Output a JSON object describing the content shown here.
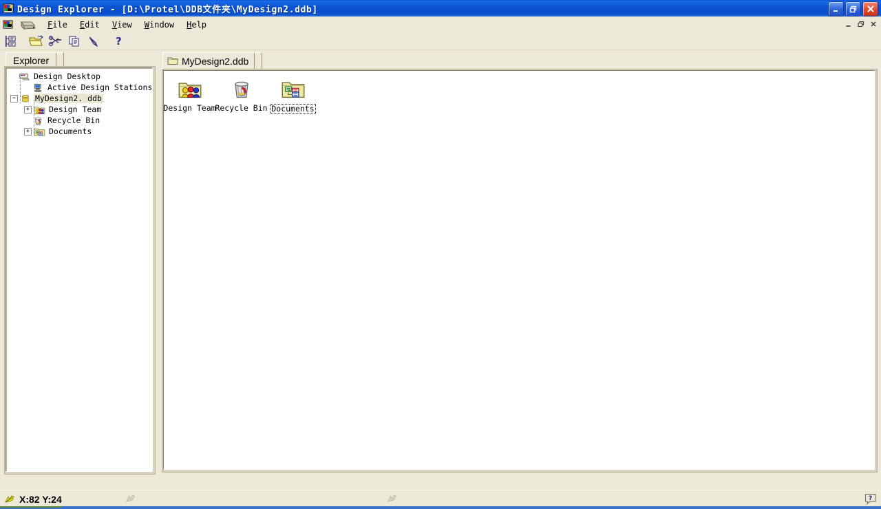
{
  "window": {
    "title": "Design Explorer - [D:\\Protel\\DDB文件夹\\MyDesign2.ddb]",
    "app_icon": "design-explorer-icon",
    "controls": {
      "minimize": "Minimize",
      "maximize": "Restore",
      "close": "Close"
    },
    "mdi_controls": {
      "minimize": "Minimize Document",
      "restore": "Restore Document",
      "close": "Close Document"
    }
  },
  "menubar": {
    "items": [
      {
        "label": "File",
        "accel": "F"
      },
      {
        "label": "Edit",
        "accel": "E"
      },
      {
        "label": "View",
        "accel": "V"
      },
      {
        "label": "Window",
        "accel": "W"
      },
      {
        "label": "Help",
        "accel": "H"
      }
    ]
  },
  "toolbar": {
    "buttons": [
      {
        "name": "design-manager-icon",
        "tooltip": "Toggle Design Manager"
      },
      {
        "name": "open-folder-icon",
        "tooltip": "Open"
      },
      {
        "name": "cut-scissors-icon",
        "tooltip": "Cut"
      },
      {
        "name": "copy-icon",
        "tooltip": "Copy"
      },
      {
        "name": "paste-icon",
        "tooltip": "Paste"
      },
      {
        "name": "help-question-icon",
        "tooltip": "Help"
      }
    ]
  },
  "explorer": {
    "tab_label": "Explorer",
    "tree": [
      {
        "label": "Design Desktop",
        "indent": 0,
        "expander": "none",
        "icon": "design-desktop-icon",
        "selected": false
      },
      {
        "label": "Active Design Stations",
        "indent": 1,
        "expander": "none",
        "icon": "design-station-icon",
        "selected": false
      },
      {
        "label": "MyDesign2. ddb",
        "indent": 0,
        "expander": "collapse",
        "icon": "ddb-database-icon",
        "selected": true
      },
      {
        "label": "Design Team",
        "indent": 1,
        "expander": "expand",
        "icon": "design-team-icon",
        "selected": false
      },
      {
        "label": "Recycle Bin",
        "indent": 1,
        "expander": "none",
        "icon": "recycle-bin-icon",
        "selected": false
      },
      {
        "label": "Documents",
        "indent": 1,
        "expander": "expand",
        "icon": "documents-folder-icon",
        "selected": false
      }
    ]
  },
  "document": {
    "tab_label": "MyDesign2.ddb",
    "tab_icon": "folder-icon",
    "items": [
      {
        "label": "Design Team",
        "icon": "design-team-icon",
        "selected": false
      },
      {
        "label": "Recycle Bin",
        "icon": "recycle-bin-icon",
        "selected": false
      },
      {
        "label": "Documents",
        "icon": "documents-folder-icon",
        "selected": true
      }
    ]
  },
  "statusbar": {
    "coords": "X:82 Y:24",
    "cursor_icon": "crosshair-cursor-icon",
    "help_icon": "help-question-icon"
  },
  "colors": {
    "title_bar": "#0b51cd",
    "chrome": "#ece9d8",
    "client": "#ffffff",
    "selection": "#e9e6d4",
    "accent_blue": "#3b72c9"
  }
}
